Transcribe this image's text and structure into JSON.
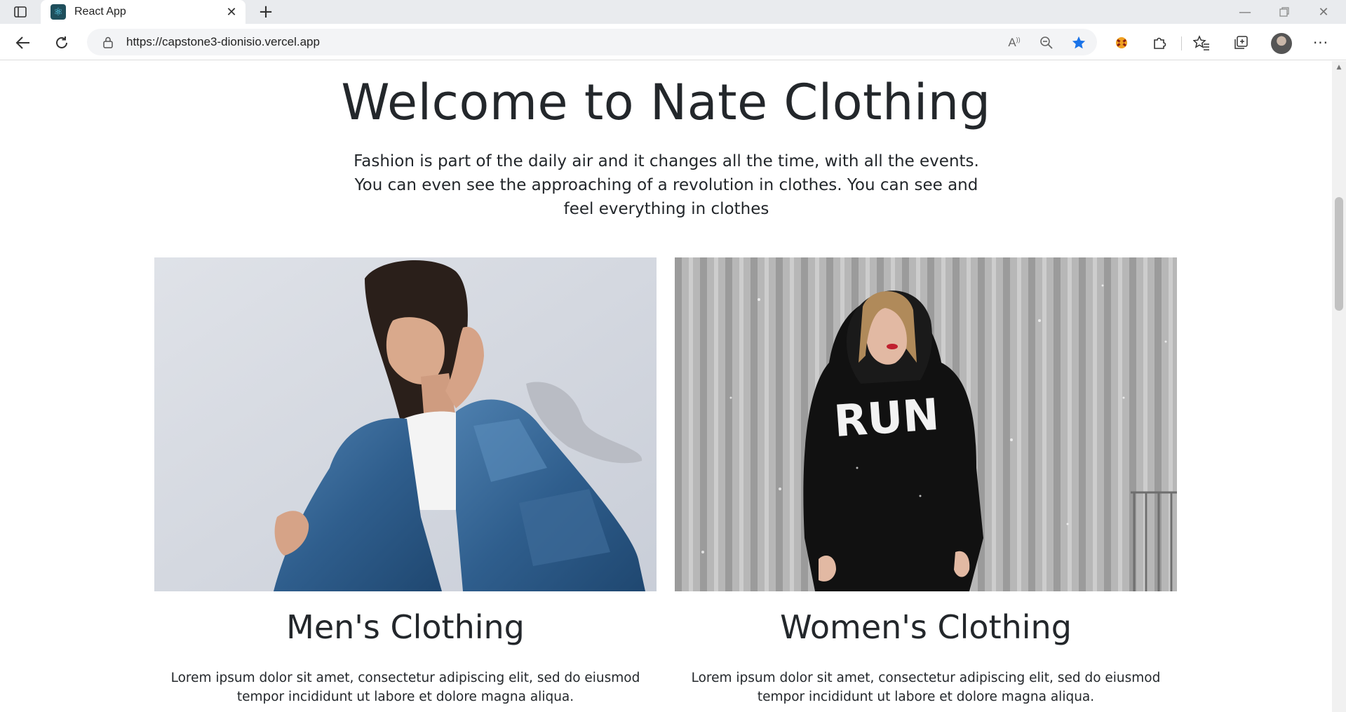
{
  "browser": {
    "tab_title": "React App",
    "url": "https://capstone3-dionisio.vercel.app",
    "icons": [
      "sidebar-toggle-icon",
      "react-favicon",
      "close-icon",
      "new-tab-icon",
      "back-icon",
      "refresh-icon",
      "lock-icon",
      "read-aloud-icon",
      "zoom-out-icon",
      "favorite-star-icon",
      "extension-icon",
      "extensions-puzzle-icon",
      "favorites-icon",
      "collections-icon",
      "profile-avatar",
      "more-icon",
      "minimize-icon",
      "restore-icon",
      "window-close-icon"
    ],
    "accent_color": "#1a73e8"
  },
  "hero": {
    "title": "Welcome to Nate Clothing",
    "text": "Fashion is part of the daily air and it changes all the time, with all the events. You can even see the approaching of a revolution in clothes. You can see and feel everything in clothes"
  },
  "cards": [
    {
      "title": "Men's Clothing",
      "text": "Lorem ipsum dolor sit amet, consectetur adipiscing elit, sed do eiusmod tempor incididunt ut labore et dolore magna aliqua."
    },
    {
      "title": "Women's Clothing",
      "image_text": "RUN",
      "text": "Lorem ipsum dolor sit amet, consectetur adipiscing elit, sed do eiusmod tempor incididunt ut labore et dolore magna aliqua."
    }
  ]
}
